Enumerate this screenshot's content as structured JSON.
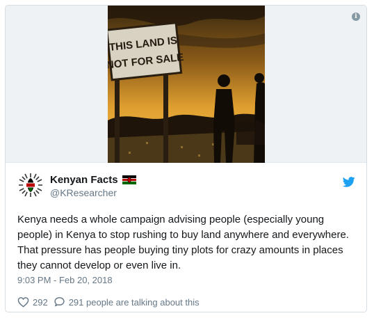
{
  "media": {
    "sign_line1": "THIS LAND IS",
    "sign_line2": "NOT FOR SALE",
    "info_icon": "i"
  },
  "author": {
    "display_name": "Kenyan Facts",
    "handle": "@KResearcher"
  },
  "tweet": {
    "text": "Kenya needs a whole campaign advising people (especially young people) in Kenya to stop rushing to buy land anywhere and everywhere. That pressure has people buying tiny plots for crazy amounts in places they cannot develop or even live in.",
    "timestamp": "9:03 PM - Feb 20, 2018"
  },
  "actions": {
    "like_count": "292",
    "talking_text": "291 people are talking about this"
  },
  "icons": {
    "brand": "twitter-icon",
    "like": "heart-icon",
    "reply": "reply-icon",
    "flag": "kenya-flag-icon",
    "info": "info-icon"
  },
  "colors": {
    "twitter_blue": "#1da1f2",
    "text_primary": "#14171a",
    "text_secondary": "#657786"
  }
}
